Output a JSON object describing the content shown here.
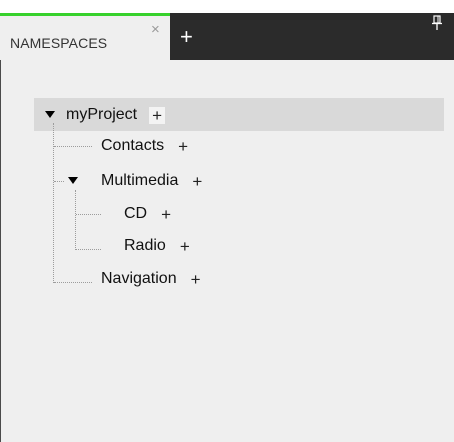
{
  "tabbar": {
    "active_tab_label": "NAMESPACES",
    "close_symbol": "×",
    "add_symbol": "+",
    "accent_color": "#37d12c",
    "pin_icon": "pin-icon"
  },
  "tree": {
    "add_symbol": "+",
    "root": {
      "label": "myProject",
      "expanded": true
    },
    "contacts": {
      "label": "Contacts"
    },
    "multimedia": {
      "label": "Multimedia",
      "expanded": true
    },
    "cd": {
      "label": "CD"
    },
    "radio": {
      "label": "Radio"
    },
    "navigation": {
      "label": "Navigation"
    }
  }
}
